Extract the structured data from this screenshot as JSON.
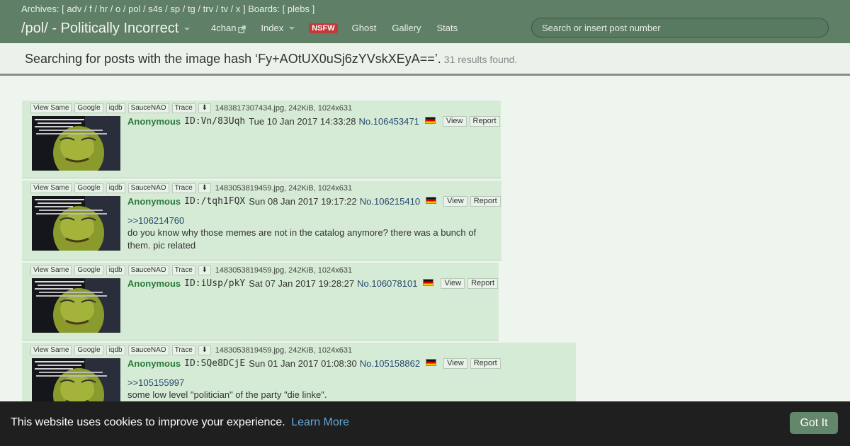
{
  "header": {
    "archives_label": "Archives: [",
    "boards_label": "Boards: [",
    "archive_boards": [
      "adv",
      "f",
      "hr",
      "o",
      "pol",
      "s4s",
      "sp",
      "tg",
      "trv",
      "tv",
      "x"
    ],
    "other_boards": [
      "plebs"
    ],
    "board_title": "/pol/ - Politically Incorrect",
    "nav": {
      "fourchan": "4chan",
      "index": "Index",
      "nsfw": "NSFW",
      "ghost": "Ghost",
      "gallery": "Gallery",
      "stats": "Stats"
    },
    "search_placeholder": "Search or insert post number"
  },
  "results": {
    "text": "Searching for posts with the image hash ‘Fy+AOtUX0uSj6zYVskXEyA==’.",
    "count": "31 results found."
  },
  "file_buttons": {
    "view_same": "View Same",
    "google": "Google",
    "iqdb": "iqdb",
    "saucenao": "SauceNAO",
    "trace": "Trace"
  },
  "post_buttons": {
    "view": "View",
    "report": "Report"
  },
  "posts": [
    {
      "file": "1483817307434.jpg, 242KiB, 1024x631",
      "name": "Anonymous",
      "id": "ID:Vn/83Uqh",
      "date": "Tue 10 Jan 2017 14:33:28",
      "number": "No.106453471",
      "quote": "",
      "body": ""
    },
    {
      "file": "1483053819459.jpg, 242KiB, 1024x631",
      "name": "Anonymous",
      "id": "ID:/tqh1FQX",
      "date": "Sun 08 Jan 2017 19:17:22",
      "number": "No.106215410",
      "quote": ">>106214760",
      "body": "do you know why those memes are not in the catalog anymore? there was a bunch of them. pic related"
    },
    {
      "file": "1483053819459.jpg, 242KiB, 1024x631",
      "name": "Anonymous",
      "id": "ID:iUsp/pkY",
      "date": "Sat 07 Jan 2017 19:28:27",
      "number": "No.106078101",
      "quote": "",
      "body": ""
    },
    {
      "file": "1483053819459.jpg, 242KiB, 1024x631",
      "name": "Anonymous",
      "id": "ID:SQe8DCjE",
      "date": "Sun 01 Jan 2017 01:08:30",
      "number": "No.105158862",
      "quote": ">>105155997",
      "body": "some low level \"politician\" of the party \"die linke\"."
    }
  ],
  "cookie": {
    "message": "This website uses cookies to improve your experience.",
    "learn_more": "Learn More",
    "button": "Got It"
  },
  "colors": {
    "header_bg": "#5f7f66",
    "post_bg": "#d6ebd6",
    "name": "#2a7a3a",
    "link": "#26486e",
    "nsfw_badge": "#c03a3a",
    "cookie_button": "#62876a"
  }
}
